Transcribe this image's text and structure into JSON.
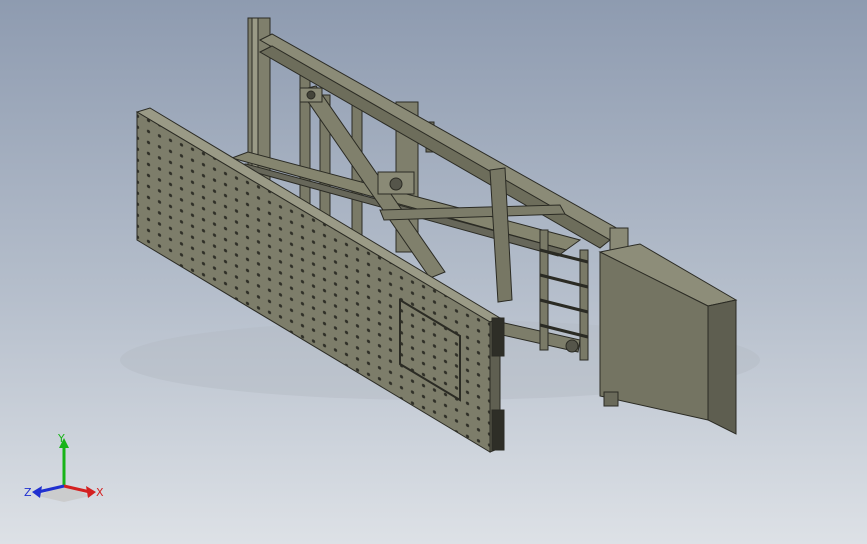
{
  "view": {
    "background_top": "#8e9bb0",
    "background_bottom": "#dde1e6",
    "model_color": "#7b7b68",
    "model_edge": "#2b2b24"
  },
  "triad": {
    "x_label": "X",
    "y_label": "Y",
    "z_label": "Z",
    "x_color": "#d42020",
    "y_color": "#18b418",
    "z_color": "#2030d0"
  }
}
